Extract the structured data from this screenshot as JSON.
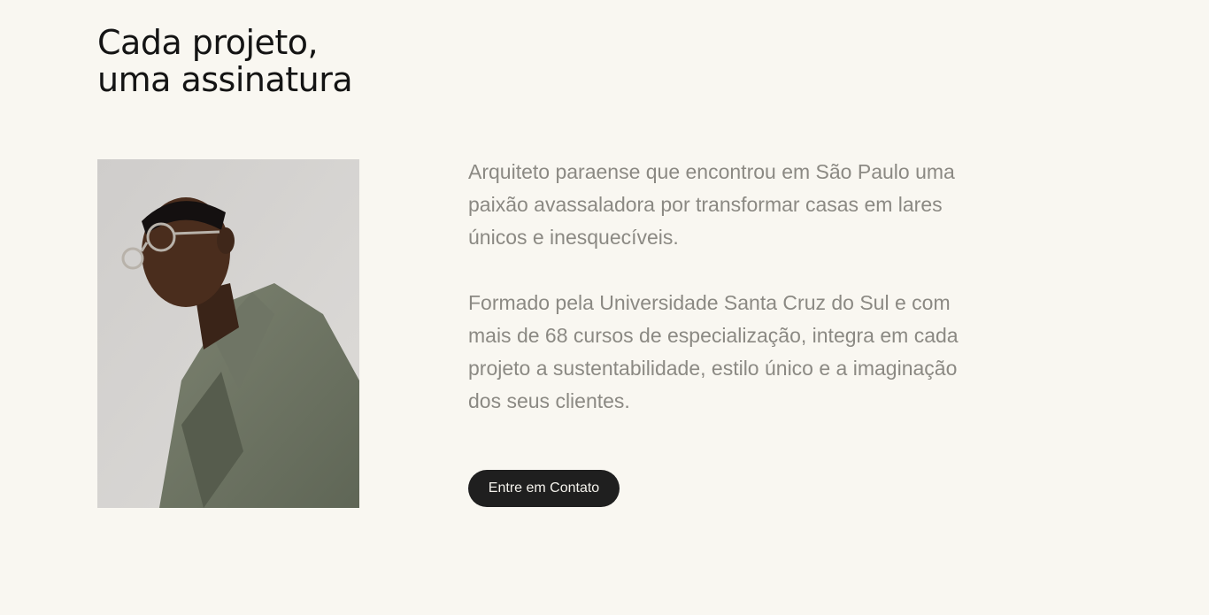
{
  "section": {
    "headline_line1": "Cada projeto,",
    "headline_line2": "uma assinatura"
  },
  "portrait": {
    "alt": "Retrato do arquiteto"
  },
  "bio": {
    "paragraph1": "Arquiteto paraense que encontrou em São Paulo uma paixão avassaladora por transformar casas em lares únicos e inesquecíveis.",
    "paragraph2": "Formado pela Universidade Santa Cruz do Sul e com mais de 68 cursos de especialização, integra em cada projeto a sustentabilidade, estilo único e a imaginação dos seus clientes."
  },
  "cta": {
    "label": "Entre em Contato"
  },
  "colors": {
    "background": "#f9f7f1",
    "text_dark": "#141414",
    "text_muted": "#8b8983",
    "button_bg": "#1f1f1f"
  }
}
